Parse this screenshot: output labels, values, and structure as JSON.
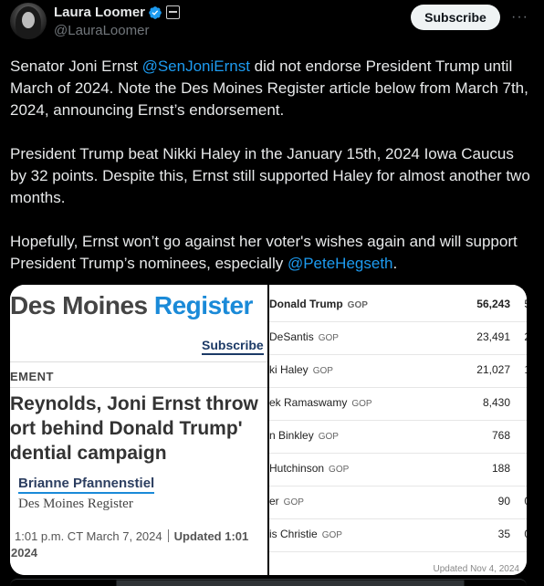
{
  "author": {
    "name": "Laura Loomer",
    "handle": "@LauraLoomer"
  },
  "header": {
    "subscribe_label": "Subscribe",
    "more_label": "···"
  },
  "tweet": {
    "p1_a": "Senator Joni Ernst ",
    "p1_mention": "@SenJoniErnst",
    "p1_b": " did not endorse President Trump until March of 2024. Note the Des Moines Register article below from March 7th, 2024, announcing Ernst’s endorsement.",
    "p2": "President Trump beat Nikki Haley in the January 15th, 2024 Iowa Caucus by 32 points. Despite this, Ernst still supported Haley for almost another two months.",
    "p3_a": "Hopefully, Ernst won’t go against her voter's wishes again and will support President Trump’s nominees, especially ",
    "p3_mention": "@PeteHegseth",
    "p3_b": "."
  },
  "article": {
    "masthead_a": "Des Moines ",
    "masthead_b": "Register",
    "subscribe": "Subscribe",
    "section": "EMENT",
    "headline_1": "Reynolds, Joni Ernst throw",
    "headline_2": "ort behind Donald Trump'",
    "headline_3": "dential campaign",
    "author": "Brianne Pfannenstiel",
    "publication": "Des Moines Register",
    "date": "1:01 p.m. CT March 7, 2024",
    "updated": "Updated 1:01",
    "updated_year": "2024"
  },
  "results": {
    "rows": [
      {
        "candidate": "Donald Trump",
        "party": "GOP",
        "votes": "56,243",
        "extra": "5"
      },
      {
        "candidate": "DeSantis",
        "party": "GOP",
        "votes": "23,491",
        "extra": "2"
      },
      {
        "candidate": "ki Haley",
        "party": "GOP",
        "votes": "21,027",
        "extra": "1"
      },
      {
        "candidate": "ek Ramaswamy",
        "party": "GOP",
        "votes": "8,430",
        "extra": ""
      },
      {
        "candidate": "n Binkley",
        "party": "GOP",
        "votes": "768",
        "extra": ""
      },
      {
        "candidate": "Hutchinson",
        "party": "GOP",
        "votes": "188",
        "extra": ""
      },
      {
        "candidate": "er",
        "party": "GOP",
        "votes": "90",
        "extra": "0"
      },
      {
        "candidate": "is Christie",
        "party": "GOP",
        "votes": "35",
        "extra": "0"
      }
    ],
    "updated_note": "Updated Nov 4, 2024"
  },
  "colors": {
    "accent": "#1d9bf0",
    "background": "#000000",
    "register_blue": "#1a8ad8"
  }
}
